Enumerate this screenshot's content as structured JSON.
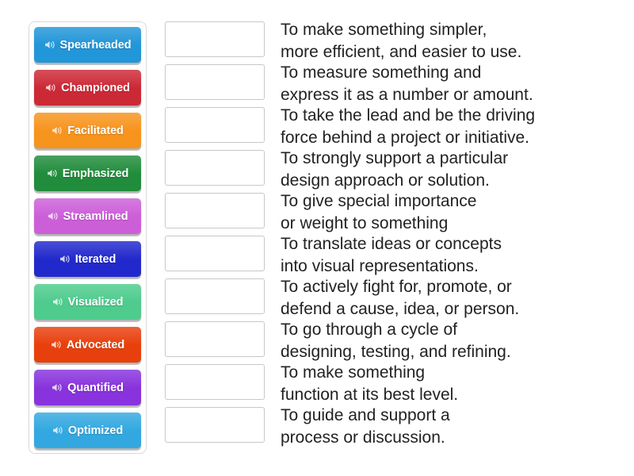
{
  "activity": {
    "type": "match-up",
    "tile_icon": "speaker-icon"
  },
  "tiles": [
    {
      "label": "Spearheaded",
      "color": "#2196d8"
    },
    {
      "label": "Championed",
      "color": "#cc2936"
    },
    {
      "label": "Facilitated",
      "color": "#f7941e"
    },
    {
      "label": "Emphasized",
      "color": "#218c3c"
    },
    {
      "label": "Streamlined",
      "color": "#cc5fd8"
    },
    {
      "label": "Iterated",
      "color": "#2229cc"
    },
    {
      "label": "Visualized",
      "color": "#4ecb8d"
    },
    {
      "label": "Advocated",
      "color": "#e8400c"
    },
    {
      "label": "Quantified",
      "color": "#8833dd"
    },
    {
      "label": "Optimized",
      "color": "#33a8e0"
    }
  ],
  "dropzones": [
    {
      "value": ""
    },
    {
      "value": ""
    },
    {
      "value": ""
    },
    {
      "value": ""
    },
    {
      "value": ""
    },
    {
      "value": ""
    },
    {
      "value": ""
    },
    {
      "value": ""
    },
    {
      "value": ""
    },
    {
      "value": ""
    }
  ],
  "definitions": [
    {
      "line1": "To make something simpler,",
      "line2": "more efficient, and easier to use."
    },
    {
      "line1": "To measure something and",
      "line2": "express it as a number or amount."
    },
    {
      "line1": "To take the lead and be the driving",
      "line2": "force behind a project or initiative."
    },
    {
      "line1": "To strongly support a particular",
      "line2": "design approach or solution."
    },
    {
      "line1": "To give special importance",
      "line2": "or weight to something"
    },
    {
      "line1": "To translate ideas or concepts",
      "line2": "into visual representations."
    },
    {
      "line1": "To actively fight for, promote, or",
      "line2": "defend a cause, idea, or person."
    },
    {
      "line1": "To go through a cycle of",
      "line2": "designing, testing, and refining."
    },
    {
      "line1": "To make something",
      "line2": "function at its best level."
    },
    {
      "line1": "To guide and support a",
      "line2": "process or discussion."
    }
  ]
}
